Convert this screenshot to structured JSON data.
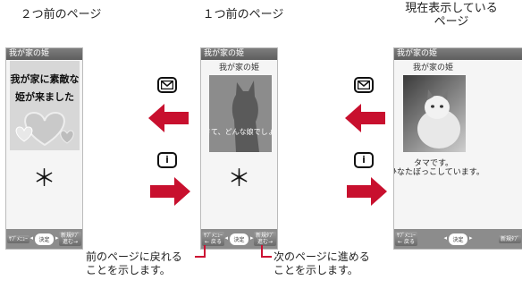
{
  "captions": {
    "left": "２つ前のページ",
    "middle": "１つ前のページ",
    "right_line1": "現在表示している",
    "right_line2": "ページ"
  },
  "phone": {
    "title": "我が家の姫",
    "softkey_left": "ｻﾌﾞﾒﾆｭｰ",
    "softkey_center": "決定",
    "softkey_right": "新規ﾀﾌﾞ",
    "middle_softkey_left_sub": "← 戻る",
    "middle_softkey_right_sub": "進む→",
    "left_softkey_right_sub": "進む→",
    "right_softkey_left_sub": "← 戻る"
  },
  "screen_left": {
    "headline_line1": "我が家に素敵な",
    "headline_line2": "姫が来ました",
    "star": "＊"
  },
  "screen_middle": {
    "subtitle": "我が家の姫",
    "overlay_text": "さて、どんな娘でしょう?",
    "star": "＊"
  },
  "screen_right": {
    "subtitle": "我が家の姫",
    "caption_line1": "タマです。",
    "caption_line2": "ひなたぼっこしています。"
  },
  "keys": {
    "mail_icon": "mail-key-icon",
    "info_icon": "i-key-icon",
    "info_glyph": "i"
  },
  "notes": {
    "back_line1": "前のページに戻れる",
    "back_line2": "ことを示します。",
    "forward_line1": "次のページに進める",
    "forward_line2": "ことを示します。"
  },
  "colors": {
    "arrow": "#c8102e",
    "titlebar": "#6e6e6e",
    "bracket": "#cc1133"
  }
}
